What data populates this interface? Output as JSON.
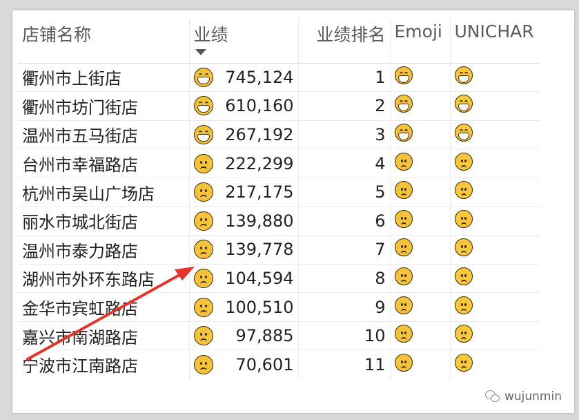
{
  "table": {
    "headers": {
      "store": "店铺名称",
      "performance": "业绩",
      "rank": "业绩排名",
      "emoji": "Emoji",
      "unichar": "UNICHAR"
    },
    "sort_icon": "sort-descending-caret-icon",
    "rows": [
      {
        "store": "衢州市上街店",
        "performance": "745,124",
        "rank": "1",
        "mood": "grin"
      },
      {
        "store": "衢州市坊门街店",
        "performance": "610,160",
        "rank": "2",
        "mood": "grin"
      },
      {
        "store": "温州市五马街店",
        "performance": "267,192",
        "rank": "3",
        "mood": "grin"
      },
      {
        "store": "台州市幸福路店",
        "performance": "222,299",
        "rank": "4",
        "mood": "sad"
      },
      {
        "store": "杭州市吴山广场店",
        "performance": "217,175",
        "rank": "5",
        "mood": "sad"
      },
      {
        "store": "丽水市城北街店",
        "performance": "139,880",
        "rank": "6",
        "mood": "sad"
      },
      {
        "store": "温州市泰力路店",
        "performance": "139,778",
        "rank": "7",
        "mood": "sad"
      },
      {
        "store": "湖州市外环东路店",
        "performance": "104,594",
        "rank": "8",
        "mood": "sad"
      },
      {
        "store": "金华市宾虹路店",
        "performance": "100,510",
        "rank": "9",
        "mood": "sad"
      },
      {
        "store": "嘉兴市南湖路店",
        "performance": "97,885",
        "rank": "10",
        "mood": "sad"
      },
      {
        "store": "宁波市江南路店",
        "performance": "70,601",
        "rank": "11",
        "mood": "sad"
      }
    ]
  },
  "icons": {
    "grin": "grinning-face-icon",
    "sad": "worried-face-icon",
    "annotation": "red-arrow-icon",
    "watermark": "wechat-icon"
  },
  "colors": {
    "emoji_yellow": "#f5c33b",
    "arrow_red": "#e5342a",
    "header_text": "#5a5a5a"
  },
  "watermark": {
    "text": "wujunmin"
  }
}
